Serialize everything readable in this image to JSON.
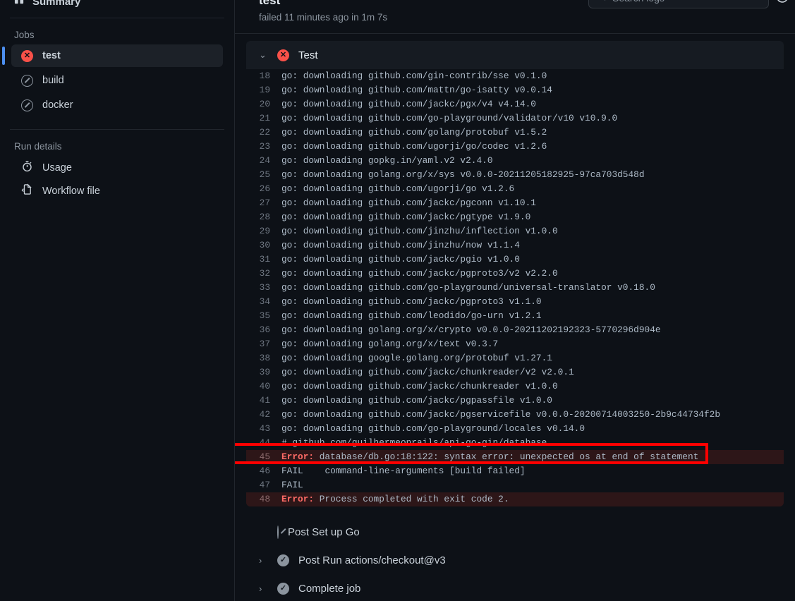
{
  "sidebar": {
    "summary_label": "Summary",
    "summary_icon": "summary-columns-icon",
    "jobs_title": "Jobs",
    "jobs": [
      {
        "label": "test",
        "status": "failure",
        "selected": true
      },
      {
        "label": "build",
        "status": "skipped",
        "selected": false
      },
      {
        "label": "docker",
        "status": "skipped",
        "selected": false
      }
    ],
    "run_details_title": "Run details",
    "run_details": [
      {
        "label": "Usage",
        "icon": "stopwatch-icon"
      },
      {
        "label": "Workflow file",
        "icon": "file-code-icon"
      }
    ]
  },
  "header": {
    "job_name": "test",
    "job_status_line": "failed 11 minutes ago in 1m 7s",
    "search": {
      "placeholder": "Search logs",
      "value": "",
      "icon": "search-icon"
    },
    "refresh_icon": "refresh-icon"
  },
  "step": {
    "name": "Test",
    "status": "failure",
    "expanded": true,
    "chevron": "⌄"
  },
  "log_lines": [
    {
      "n": "18",
      "text": "go: downloading github.com/gin-contrib/sse v0.1.0",
      "error": false
    },
    {
      "n": "19",
      "text": "go: downloading github.com/mattn/go-isatty v0.0.14",
      "error": false
    },
    {
      "n": "20",
      "text": "go: downloading github.com/jackc/pgx/v4 v4.14.0",
      "error": false
    },
    {
      "n": "21",
      "text": "go: downloading github.com/go-playground/validator/v10 v10.9.0",
      "error": false
    },
    {
      "n": "22",
      "text": "go: downloading github.com/golang/protobuf v1.5.2",
      "error": false
    },
    {
      "n": "23",
      "text": "go: downloading github.com/ugorji/go/codec v1.2.6",
      "error": false
    },
    {
      "n": "24",
      "text": "go: downloading gopkg.in/yaml.v2 v2.4.0",
      "error": false
    },
    {
      "n": "25",
      "text": "go: downloading golang.org/x/sys v0.0.0-20211205182925-97ca703d548d",
      "error": false
    },
    {
      "n": "26",
      "text": "go: downloading github.com/ugorji/go v1.2.6",
      "error": false
    },
    {
      "n": "27",
      "text": "go: downloading github.com/jackc/pgconn v1.10.1",
      "error": false
    },
    {
      "n": "28",
      "text": "go: downloading github.com/jackc/pgtype v1.9.0",
      "error": false
    },
    {
      "n": "29",
      "text": "go: downloading github.com/jinzhu/inflection v1.0.0",
      "error": false
    },
    {
      "n": "30",
      "text": "go: downloading github.com/jinzhu/now v1.1.4",
      "error": false
    },
    {
      "n": "31",
      "text": "go: downloading github.com/jackc/pgio v1.0.0",
      "error": false
    },
    {
      "n": "32",
      "text": "go: downloading github.com/jackc/pgproto3/v2 v2.2.0",
      "error": false
    },
    {
      "n": "33",
      "text": "go: downloading github.com/go-playground/universal-translator v0.18.0",
      "error": false
    },
    {
      "n": "34",
      "text": "go: downloading github.com/jackc/pgproto3 v1.1.0",
      "error": false
    },
    {
      "n": "35",
      "text": "go: downloading github.com/leodido/go-urn v1.2.1",
      "error": false
    },
    {
      "n": "36",
      "text": "go: downloading golang.org/x/crypto v0.0.0-20211202192323-5770296d904e",
      "error": false
    },
    {
      "n": "37",
      "text": "go: downloading golang.org/x/text v0.3.7",
      "error": false
    },
    {
      "n": "38",
      "text": "go: downloading google.golang.org/protobuf v1.27.1",
      "error": false
    },
    {
      "n": "39",
      "text": "go: downloading github.com/jackc/chunkreader/v2 v2.0.1",
      "error": false
    },
    {
      "n": "40",
      "text": "go: downloading github.com/jackc/chunkreader v1.0.0",
      "error": false
    },
    {
      "n": "41",
      "text": "go: downloading github.com/jackc/pgpassfile v1.0.0",
      "error": false
    },
    {
      "n": "42",
      "text": "go: downloading github.com/jackc/pgservicefile v0.0.0-20200714003250-2b9c44734f2b",
      "error": false
    },
    {
      "n": "43",
      "text": "go: downloading github.com/go-playground/locales v0.14.0",
      "error": false
    },
    {
      "n": "44",
      "text": "# github.com/guilhermeonrails/api-go-gin/database",
      "error": false
    },
    {
      "n": "45",
      "prefix": "Error:",
      "text": " database/db.go:18:122: syntax error: unexpected os at end of statement",
      "error": true
    },
    {
      "n": "46",
      "text": "FAIL\tcommand-line-arguments [build failed]",
      "error": false
    },
    {
      "n": "47",
      "text": "FAIL",
      "error": false
    },
    {
      "n": "48",
      "prefix": "Error:",
      "text": " Process completed with exit code 2.",
      "error": true
    }
  ],
  "post_steps": [
    {
      "label": "Post Set up Go",
      "status": "skipped",
      "has_chevron": false
    },
    {
      "label": "Post Run actions/checkout@v3",
      "status": "success",
      "has_chevron": true
    },
    {
      "label": "Complete job",
      "status": "success",
      "has_chevron": true
    }
  ],
  "annotation": {
    "color": "#ff0000",
    "target_line": "45"
  },
  "colors": {
    "background": "#0d1117",
    "panel": "#161b22",
    "error_row": "#2d1618",
    "error_text": "#ff6b66",
    "accent": "#4d8ff0",
    "failure": "#f85149",
    "muted": "#8b949e"
  }
}
